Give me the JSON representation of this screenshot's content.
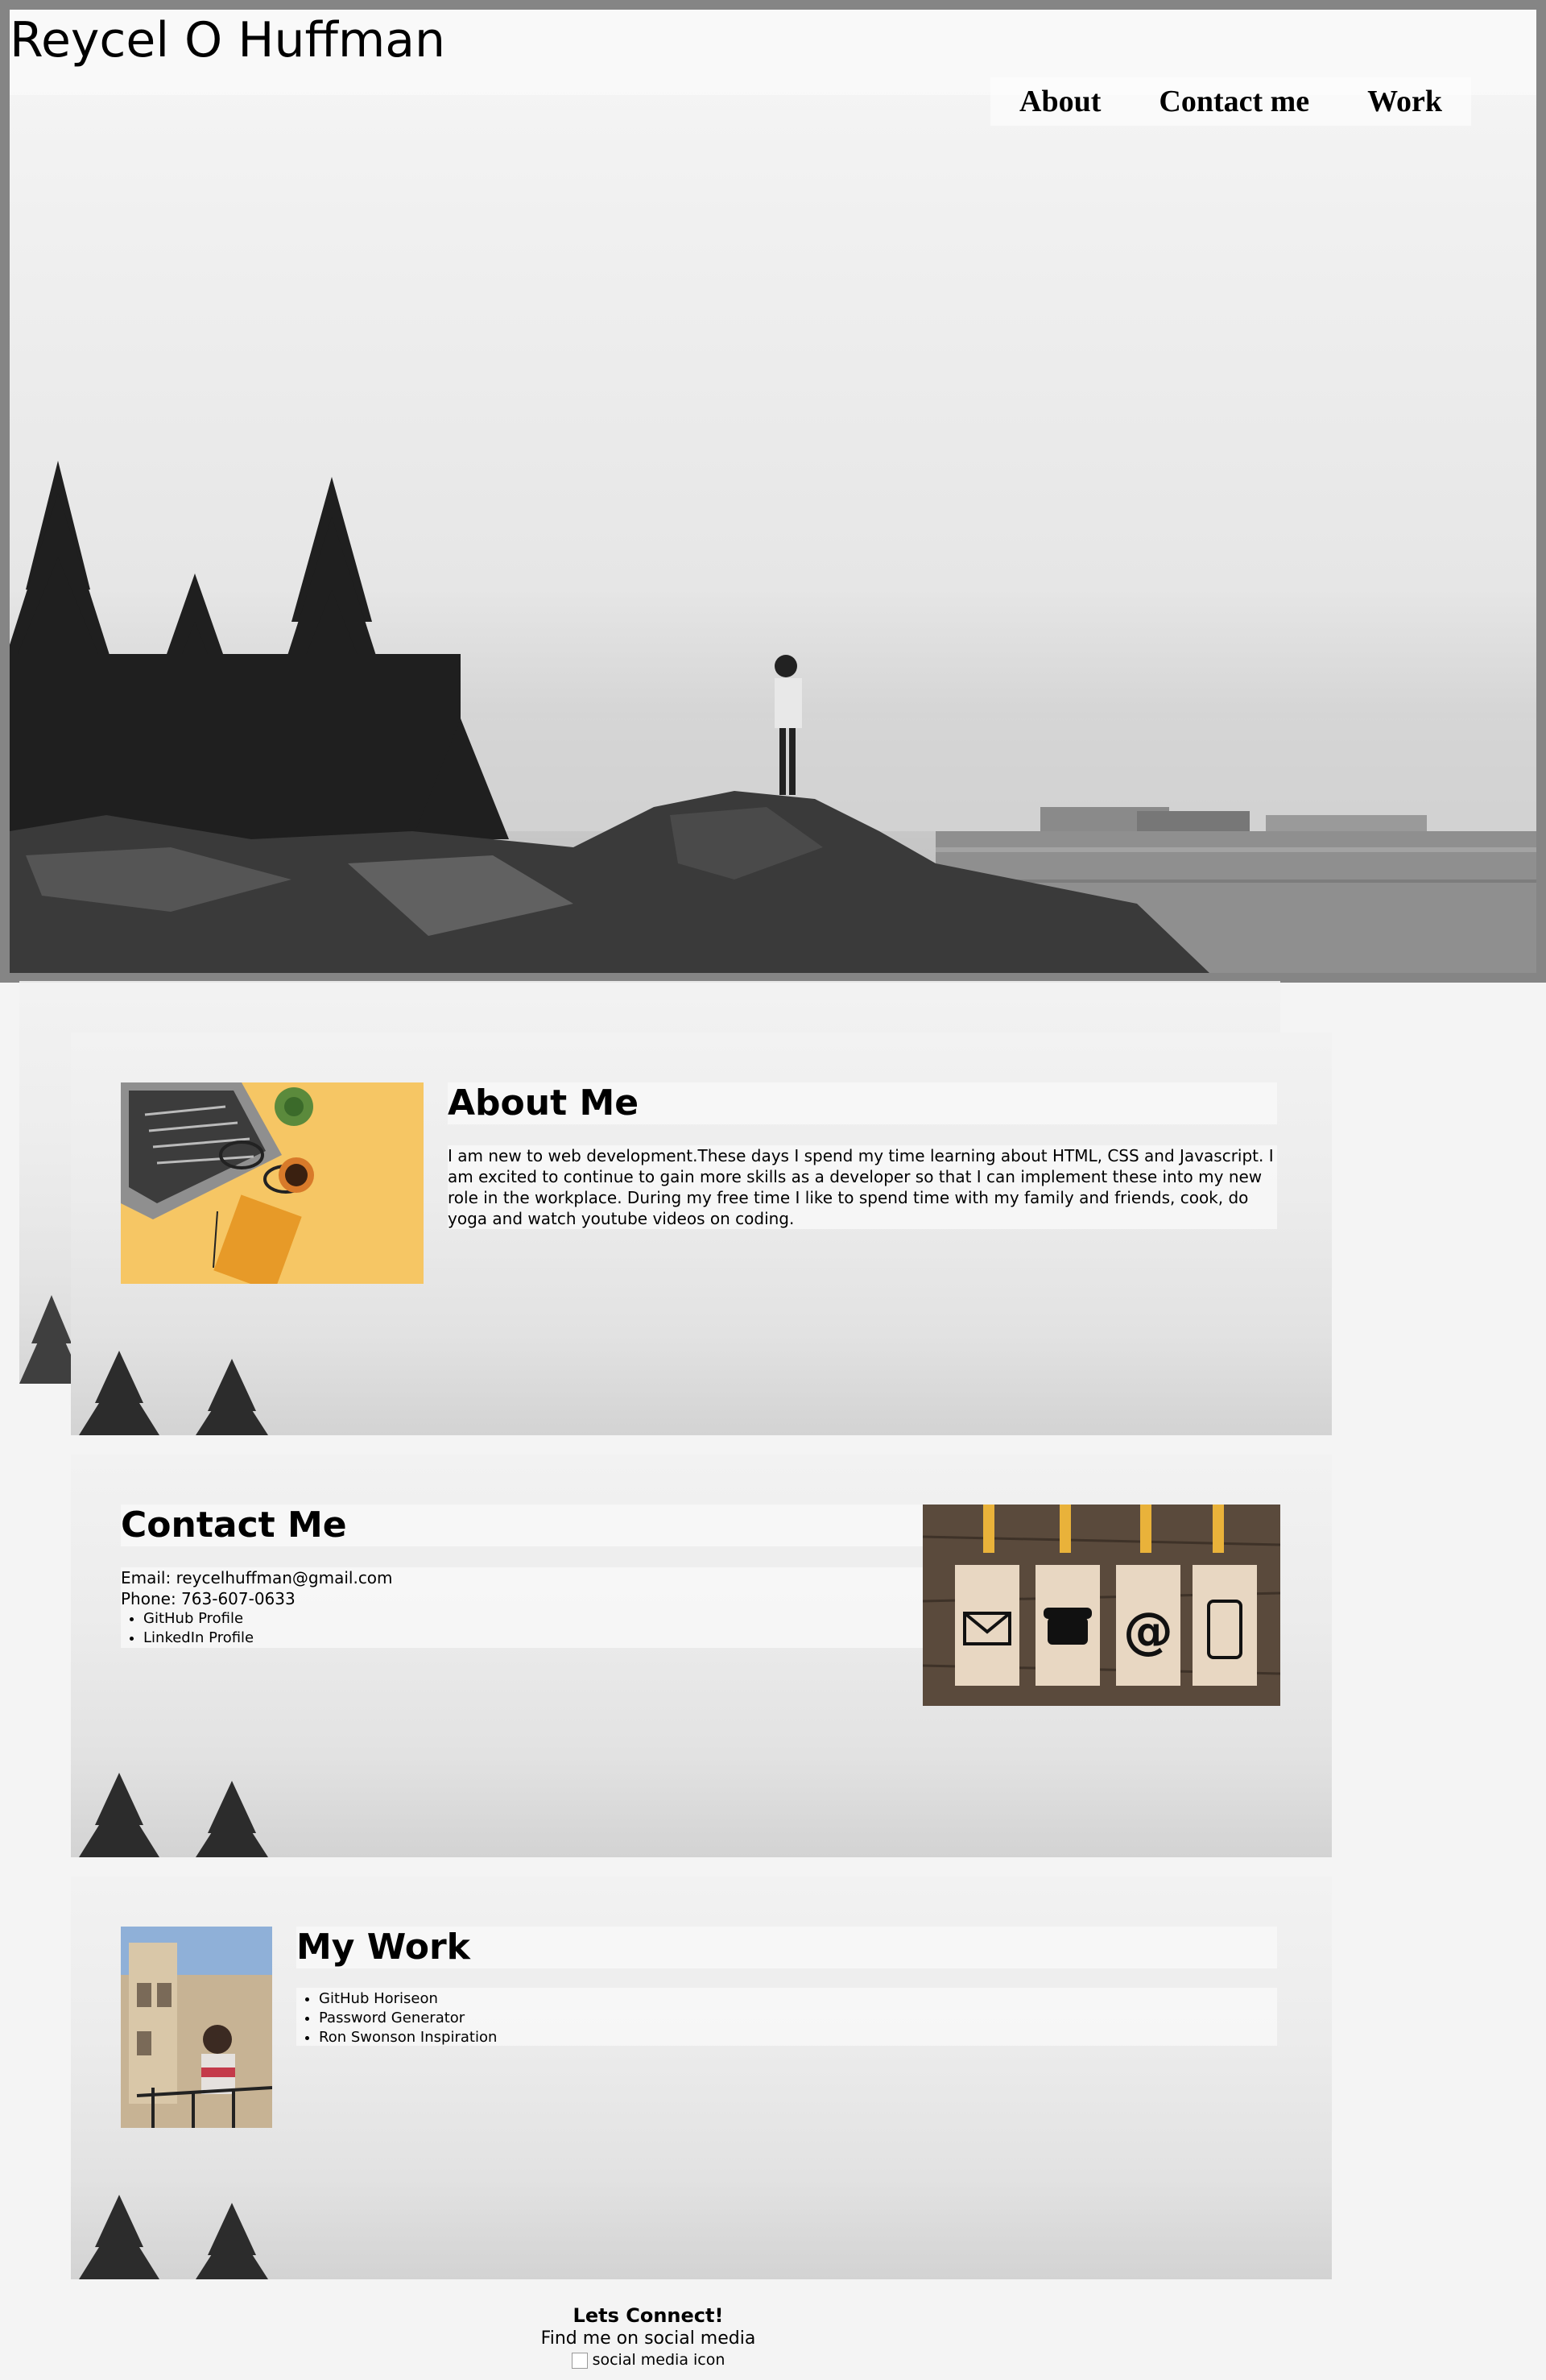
{
  "header": {
    "site_title": "Reycel O Huffman",
    "nav": [
      {
        "label": "About"
      },
      {
        "label": "Contact me"
      },
      {
        "label": "Work"
      }
    ]
  },
  "about": {
    "title": "About Me",
    "body": "I am new to web development.These days I spend my time learning about HTML, CSS and Javascript. I am excited to continue to gain more skills as a developer so that I can implement these into my new role in the workplace. During my free time I like to spend time with my family and friends, cook, do yoga and watch youtube videos on coding."
  },
  "contact": {
    "title": "Contact Me",
    "email": "Email: reycelhuffman@gmail.com",
    "phone": "Phone: 763-607-0633",
    "links": [
      "GitHub Profile",
      "LinkedIn Profile"
    ]
  },
  "work": {
    "title": "My Work",
    "projects": [
      "GitHub Horiseon",
      "Password Generator",
      "Ron Swonson Inspiration"
    ]
  },
  "footer": {
    "title": "Lets Connect!",
    "subtitle": "Find me on social media",
    "icon_alt": "social media icon"
  },
  "colors": {
    "page_background": "#f4f4f4",
    "hero_frame": "#858585",
    "card_yellow": "#f6c664",
    "wood": "#5a4a3c",
    "tag_yellow": "#e9b23a"
  },
  "icons": [
    "envelope-icon",
    "telephone-icon",
    "at-sign-icon",
    "mobile-phone-icon"
  ]
}
